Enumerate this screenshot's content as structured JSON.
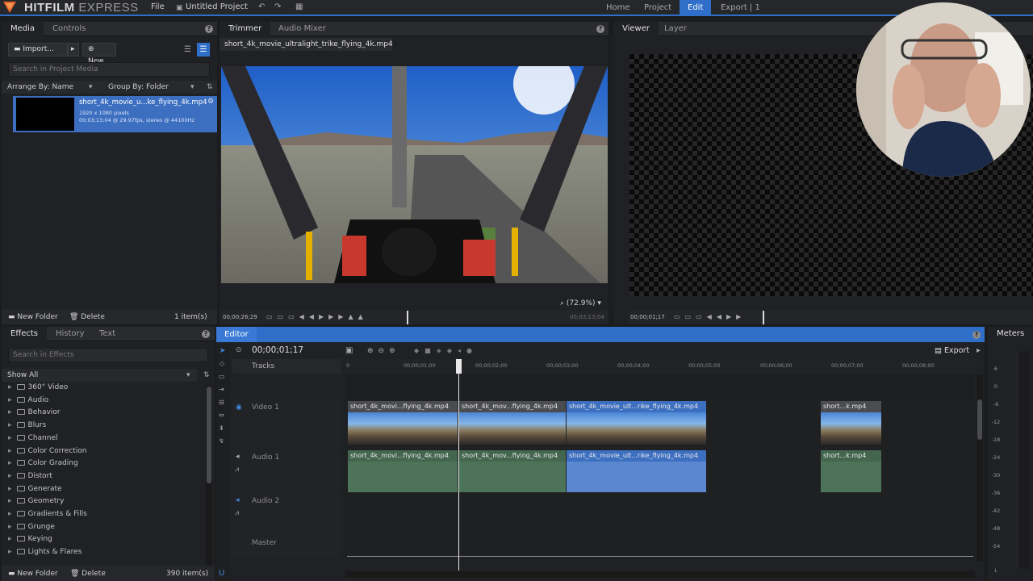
{
  "app": {
    "title_bold": "HITFILM",
    "title_light": " EXPRESS",
    "file_menu": "File",
    "project_name": "Untitled Project",
    "nav": [
      "Home",
      "Project",
      "Edit",
      "Export | 1"
    ]
  },
  "media_panel": {
    "tabs": [
      "Media",
      "Controls"
    ],
    "import_label": "Import...",
    "new_label": "New",
    "search_placeholder": "Search in Project Media",
    "arrange_by": "Arrange By: Name",
    "group_by": "Group By: Folder",
    "item": {
      "name": "short_4k_movie_u...ke_flying_4k.mp4",
      "resolution": "1920 x 1080 pixels",
      "details": "00;03;13;04 @ 29.97fps, stereo @ 44100Hz"
    },
    "new_folder": "New Folder",
    "delete": "Delete",
    "count": "1 item(s)"
  },
  "trimmer": {
    "tabs": [
      "Trimmer",
      "Audio Mixer"
    ],
    "clip_name": "short_4k_movie_ultralight_trike_flying_4k.mp4",
    "zoom": "(72.9%)",
    "timecode_in": "00;00;26;29",
    "timecode_dur": "00;03;13;04"
  },
  "viewer": {
    "tabs": [
      "Viewer",
      "Layer"
    ],
    "timecode": "00;00;01;17"
  },
  "effects_panel": {
    "tabs": [
      "Effects",
      "History",
      "Text"
    ],
    "search_placeholder": "Search in Effects",
    "filter": "Show All",
    "categories": [
      "360° Video",
      "Audio",
      "Behavior",
      "Blurs",
      "Channel",
      "Color Correction",
      "Color Grading",
      "Distort",
      "Generate",
      "Geometry",
      "Gradients & Fills",
      "Grunge",
      "Keying",
      "Lights & Flares"
    ],
    "new_folder": "New Folder",
    "delete": "Delete",
    "count": "390 item(s)"
  },
  "editor": {
    "tab": "Editor",
    "timecode": "00;00;01;17",
    "export_label": "Export",
    "tracks_label": "Tracks",
    "ruler": [
      "0",
      "00;00;01;00",
      "00;00;02;00",
      "00;00;03;00",
      "00;00;04;00",
      "00;00;05;00",
      "00;00;06;00",
      "00;00;07;00",
      "00;00;08;00"
    ],
    "tracks": [
      "Video 1",
      "Audio 1",
      "Audio 2",
      "Master"
    ],
    "video_clips": [
      {
        "name": "short_4k_movi...flying_4k.mp4"
      },
      {
        "name": "short_4k_mov...flying_4k.mp4"
      },
      {
        "name": "short_4k_movie_ult...rike_flying_4k.mp4"
      },
      {
        "name": "short...k.mp4"
      }
    ],
    "audio_clips": [
      {
        "name": "short_4k_movi...flying_4k.mp4"
      },
      {
        "name": "short_4k_mov...flying_4k.mp4"
      },
      {
        "name": "short_4k_movie_ult...rike_flying_4k.mp4"
      },
      {
        "name": "short...k.mp4"
      }
    ]
  },
  "meters": {
    "tab": "Meters",
    "scale": [
      "6",
      "0",
      "-6",
      "-12",
      "-18",
      "-24",
      "-30",
      "-36",
      "-42",
      "-48",
      "-54"
    ],
    "channel": "L"
  }
}
